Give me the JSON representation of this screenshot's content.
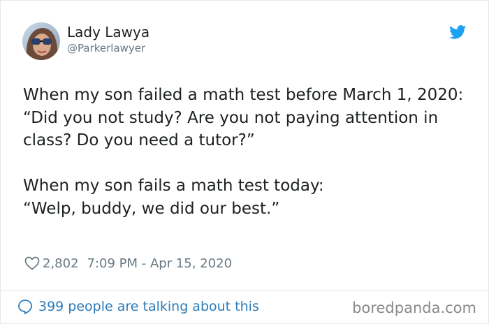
{
  "author": {
    "name": "Lady Lawya",
    "handle": "@Parkerlawyer",
    "avatar_icon": "profile-photo"
  },
  "tweet": {
    "lines": [
      "When my son failed a math test before March 1, 2020:",
      "“Did you not study? Are you not paying attention in class? Do you need a tutor?”",
      "",
      "When my son fails a math test today:",
      "“Welp, buddy, we did our best.”"
    ],
    "likes": "2,802",
    "timestamp": "7:09 PM - Apr 15, 2020"
  },
  "footer": {
    "conversation_label": "399 people are talking about this",
    "watermark": "boredpanda.com"
  },
  "colors": {
    "twitter_blue": "#1da1f2",
    "link_blue": "#2b7bb9",
    "muted_gray": "#697882",
    "text": "#1c2022"
  },
  "icons": [
    "twitter-bird-icon",
    "heart-icon",
    "speech-bubble-icon"
  ]
}
